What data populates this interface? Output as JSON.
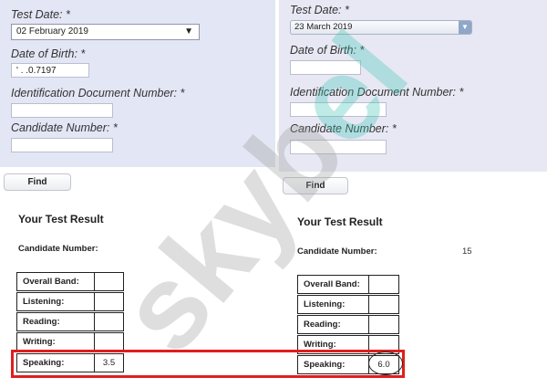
{
  "left": {
    "test_date_label": "Test Date: *",
    "test_date_value": "02 February 2019",
    "dob_label": "Date of Birth: *",
    "dob_value": "' . .0.7197",
    "id_label": "Identification Document Number: *",
    "candidate_label": "Candidate Number: *",
    "find_label": "Find",
    "result_title": "Your Test Result",
    "candidate_number_label": "Candidate Number:",
    "rows": [
      {
        "label": "Overall Band:",
        "value": ""
      },
      {
        "label": "Listening:",
        "value": ""
      },
      {
        "label": "Reading:",
        "value": ""
      },
      {
        "label": "Writing:",
        "value": ""
      },
      {
        "label": "Speaking:",
        "value": "3.5"
      }
    ]
  },
  "right": {
    "test_date_label": "Test Date: *",
    "test_date_value": "23 March 2019",
    "dob_label": "Date of Birth: *",
    "id_label": "Identification Document Number: *",
    "candidate_label": "Candidate Number: *",
    "find_label": "Find",
    "result_title": "Your Test Result",
    "candidate_number_label": "Candidate Number:",
    "candidate_number_value": "15",
    "rows": [
      {
        "label": "Overall Band:",
        "value": ""
      },
      {
        "label": "Listening:",
        "value": ""
      },
      {
        "label": "Reading:",
        "value": ""
      },
      {
        "label": "Writing:",
        "value": ""
      },
      {
        "label": "Speaking:",
        "value": "6.0"
      }
    ]
  },
  "watermark": {
    "text": "skybel",
    "color_main": "#9a9a9a",
    "color_accent": "#3cc3b4"
  },
  "highlight_color": "#e01e1e"
}
